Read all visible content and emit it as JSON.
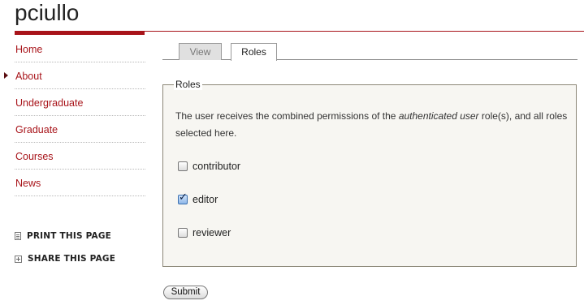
{
  "site": {
    "title": "pciullo"
  },
  "sidebar": {
    "items": [
      {
        "label": "Home",
        "active": false
      },
      {
        "label": "About",
        "active": true
      },
      {
        "label": "Undergraduate",
        "active": false
      },
      {
        "label": "Graduate",
        "active": false
      },
      {
        "label": "Courses",
        "active": false
      },
      {
        "label": "News",
        "active": false
      }
    ],
    "utilities": {
      "print": "PRINT THIS PAGE",
      "share": "SHARE THIS PAGE"
    }
  },
  "tabs": [
    {
      "label": "View",
      "active": false
    },
    {
      "label": "Roles",
      "active": true
    }
  ],
  "roles": {
    "legend": "Roles",
    "description_pre": "The user receives the combined permissions of the ",
    "description_em": "authenticated user",
    "description_post": " role(s), and all roles selected here.",
    "options": [
      {
        "label": "contributor",
        "checked": false
      },
      {
        "label": "editor",
        "checked": true
      },
      {
        "label": "reviewer",
        "checked": false
      }
    ]
  },
  "form": {
    "submit_label": "Submit"
  },
  "colors": {
    "accent": "#a8141a",
    "fieldset_bg": "#f7f6f2"
  }
}
